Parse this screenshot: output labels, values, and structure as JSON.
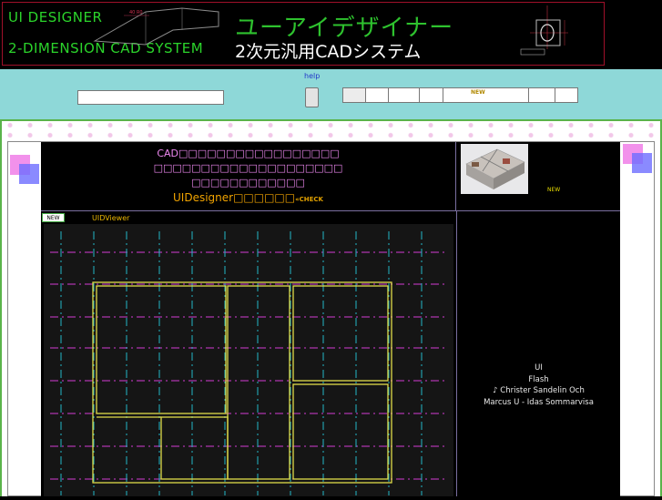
{
  "banner": {
    "title_en_line1": "UI DESIGNER",
    "title_en_line2": "2-DIMENSION CAD SYSTEM",
    "title_jp": "ユーアイデザイナー",
    "subtitle_jp": "2次元汎用CADシステム"
  },
  "nav": {
    "help_label": "help",
    "search_value": "",
    "tabs": [
      "",
      "",
      "",
      "",
      "",
      "NEW",
      "",
      ""
    ]
  },
  "promo": {
    "line1": "CAD□□□□□□□□□□□□□□□□□",
    "line2": "□□□□□□□□□□□□□□□□□□□□",
    "line3": "□□□□□□□□□□□□",
    "line4": "UIDesigner□□□□□□",
    "check_label": "«CHECK",
    "new_label": "NEW"
  },
  "viewer": {
    "new_tag": "NEW",
    "title": "UIDViewer"
  },
  "right": {
    "line1": "UI",
    "line2": "Flash",
    "line3": "♪ Christer Sandelin Och",
    "line4": "Marcus U - Idas Sommarvisa"
  },
  "colors": {
    "banner_title": "#2bd42b",
    "nav_bg": "#8ed8d8",
    "promo_text": "#ee88f0",
    "accent_orange": "#f2a400",
    "grid_magenta": "#d23ad2",
    "grid_cyan": "#22b8c8",
    "wall_yellow": "#e0dc4a"
  }
}
